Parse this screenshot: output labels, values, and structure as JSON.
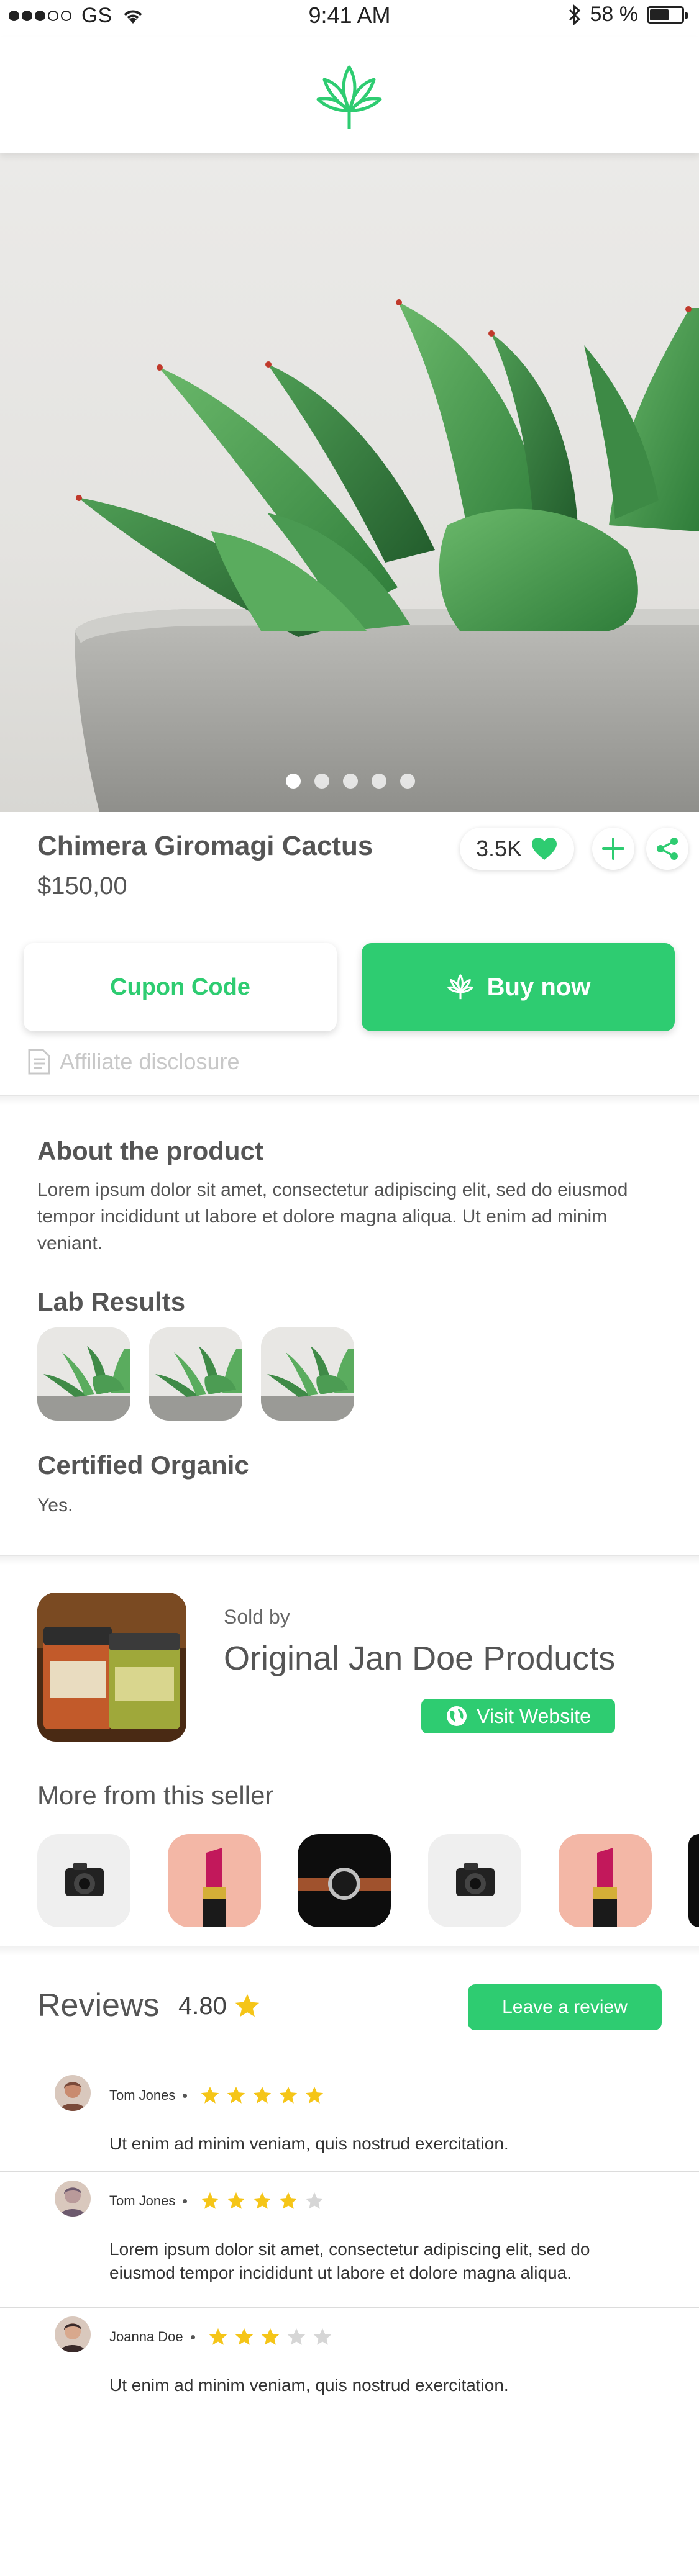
{
  "status_bar": {
    "carrier": "GS",
    "time": "9:41 AM",
    "battery": "58 %",
    "battery_level": 0.58
  },
  "colors": {
    "accent": "#2ecc71",
    "text": "#555555",
    "star": "#f5c518",
    "star_empty": "#d6d6d6"
  },
  "product": {
    "title": "Chimera Giromagi Cactus",
    "price": "$150,00",
    "likes": "3.5K",
    "image_count": 5,
    "active_image": 1
  },
  "actions": {
    "coupon_label": "Cupon Code",
    "buy_label": "Buy now",
    "affiliate_label": "Affiliate disclosure"
  },
  "about": {
    "heading": "About the product",
    "text": "Lorem ipsum dolor sit amet, consectetur adipiscing elit, sed do eiusmod tempor incididunt ut labore et dolore magna aliqua. Ut enim ad minim veniant."
  },
  "lab": {
    "heading": "Lab Results"
  },
  "organic": {
    "heading": "Certified Organic",
    "value": "Yes."
  },
  "seller": {
    "sold_by_label": "Sold by",
    "name": "Original Jan Doe Products",
    "visit_label": "Visit Website"
  },
  "more": {
    "heading": "More from this seller"
  },
  "reviews": {
    "heading": "Reviews",
    "rating": "4.80",
    "leave_label": "Leave a review",
    "items": [
      {
        "name": "Tom Jones",
        "stars": 5,
        "text": "Ut enim ad minim veniam, quis nostrud exercitation."
      },
      {
        "name": "Tom Jones",
        "stars": 4,
        "text": "Lorem ipsum dolor sit amet, consectetur adipiscing elit, sed do eiusmod tempor incididunt ut labore et dolore magna aliqua."
      },
      {
        "name": "Joanna Doe",
        "stars": 3,
        "text": "Ut enim ad minim veniam, quis nostrud exercitation."
      }
    ]
  },
  "icons": {
    "logo": "cannabis-leaf-icon",
    "like": "heart-icon",
    "add": "plus-icon",
    "share": "share-icon",
    "affiliate": "document-icon",
    "website": "globe-icon",
    "rating": "star-icon"
  }
}
